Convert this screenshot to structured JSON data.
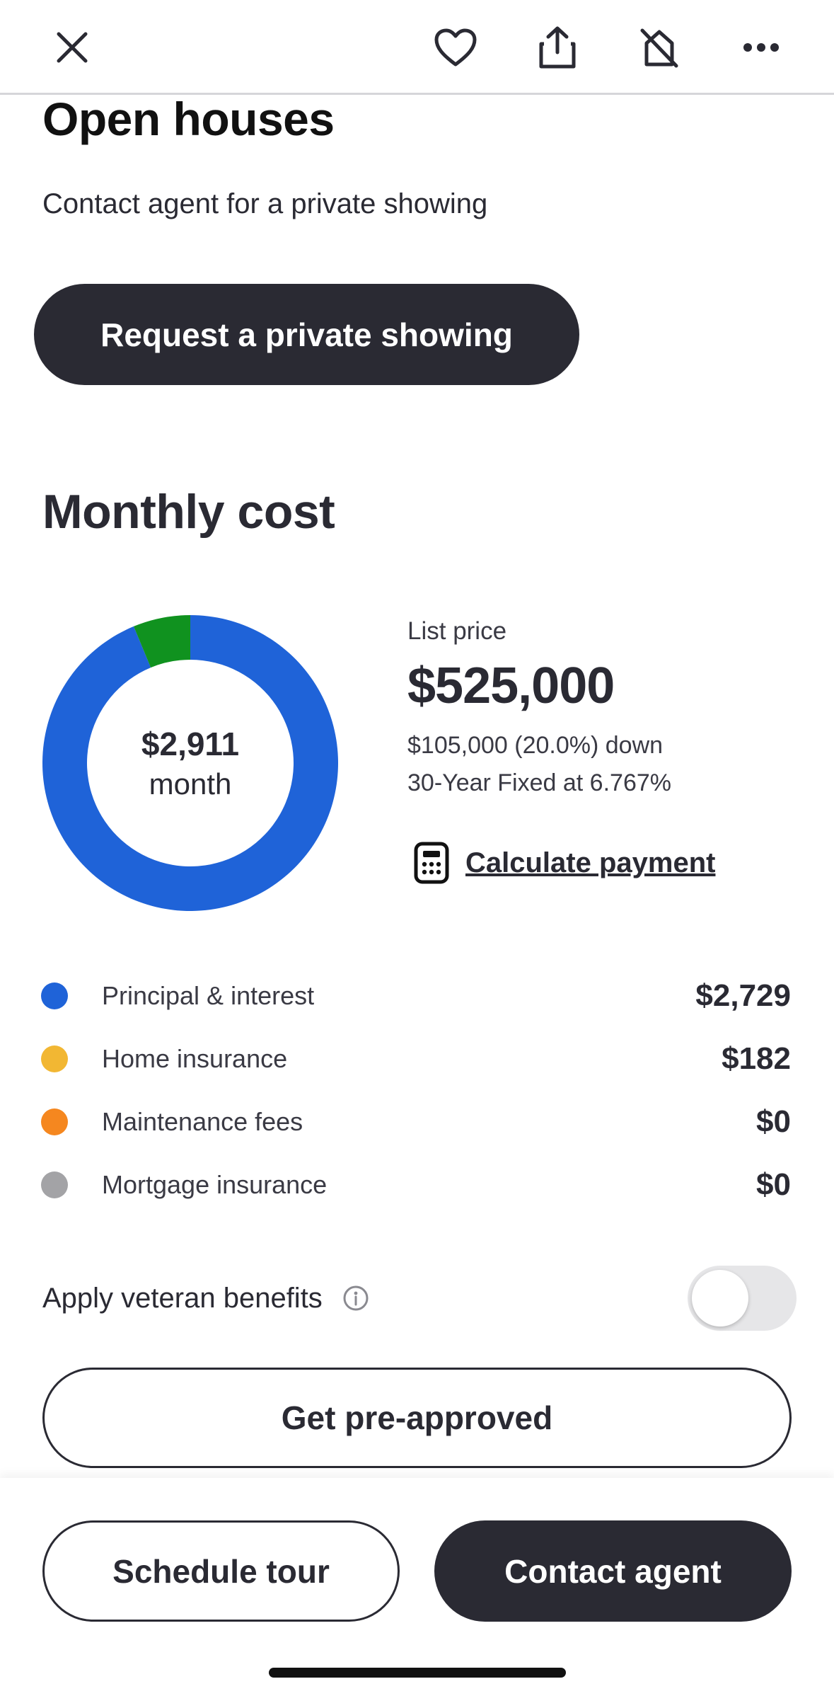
{
  "top_bar": {
    "icons": [
      "close-icon",
      "heart-icon",
      "share-icon",
      "hide-icon",
      "more-icon"
    ]
  },
  "open_houses": {
    "title": "Open houses",
    "subtitle": "Contact agent for a private showing",
    "button_label": "Request a private showing"
  },
  "monthly_cost": {
    "title": "Monthly cost",
    "total_amount": "$2,911",
    "total_unit": "month",
    "list_price_label": "List price",
    "list_price": "$525,000",
    "down_payment": "$105,000 (20.0%) down",
    "loan_terms": "30-Year Fixed at 6.767%",
    "calculate_label": "Calculate payment",
    "breakdown": [
      {
        "label": "Principal & interest",
        "value": "$2,729",
        "amount": 2729,
        "color": "#1f63d8"
      },
      {
        "label": "Home insurance",
        "value": "$182",
        "amount": 182,
        "color": "#f2b733"
      },
      {
        "label": "Maintenance fees",
        "value": "$0",
        "amount": 0,
        "color": "#f5871f"
      },
      {
        "label": "Mortgage insurance",
        "value": "$0",
        "amount": 0,
        "color": "#a3a3a6"
      }
    ],
    "donut_segments": [
      {
        "name": "principal-interest",
        "amount": 2729,
        "color": "#1f63d8"
      },
      {
        "name": "home-insurance",
        "amount": 182,
        "color": "#10921f"
      }
    ]
  },
  "veteran": {
    "label": "Apply veteran benefits",
    "enabled": false
  },
  "buttons": {
    "preapproved": "Get pre-approved",
    "schedule_tour": "Schedule tour",
    "contact_agent": "Contact agent"
  }
}
